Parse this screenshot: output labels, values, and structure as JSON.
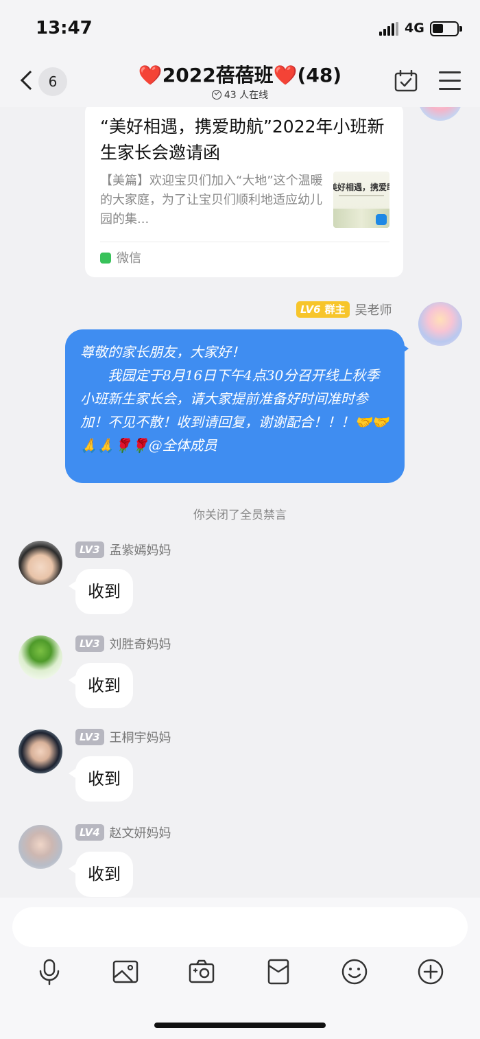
{
  "status_bar": {
    "time": "13:47",
    "network": "4G",
    "battery_level": 0.45
  },
  "header": {
    "back_count": "6",
    "title": "❤️2022蓓蓓班❤️(48)",
    "online_status": "43 人在线"
  },
  "link_card": {
    "title": "“美好相遇，携爱助航”2022年小班新生家长会邀请函",
    "description": "【美篇】欢迎宝贝们加入“大地”这个温暖的大家庭，为了让宝贝们顺利地适应幼儿园的集...",
    "thumb_title": "美好相遇，携爱助航",
    "source": "微信"
  },
  "teacher_message": {
    "level": "LV6",
    "role": "群主",
    "sender": "吴老师",
    "line1": "尊敬的家长朋友，大家好！",
    "line2": "我园定于8月16日下午4点30分召开线上秋季小班新生家长会，请大家提前准备好时间准时参加！不见不散！收到请回复，谢谢配合！！！🤝🤝🙏🙏🌹🌹@全体成员"
  },
  "system_message": "你关闭了全员禁言",
  "replies": [
    {
      "level": "LV3",
      "sender": "孟紫嫣妈妈",
      "text": "收到"
    },
    {
      "level": "LV3",
      "sender": "刘胜奇妈妈",
      "text": "收到"
    },
    {
      "level": "LV3",
      "sender": "王桐宇妈妈",
      "text": "收到"
    },
    {
      "level": "LV4",
      "sender": "赵文妍妈妈",
      "text": "收到"
    }
  ],
  "input": {
    "placeholder": ""
  },
  "toolbar_icons": [
    "microphone-icon",
    "photo-icon",
    "camera-icon",
    "red-packet-icon",
    "emoji-icon",
    "plus-icon"
  ],
  "colors": {
    "bubble_blue": "#3f8df1",
    "gold_badge": "#f7c52b",
    "gray_badge": "#b7b7c0",
    "background": "#f1f1f3"
  }
}
